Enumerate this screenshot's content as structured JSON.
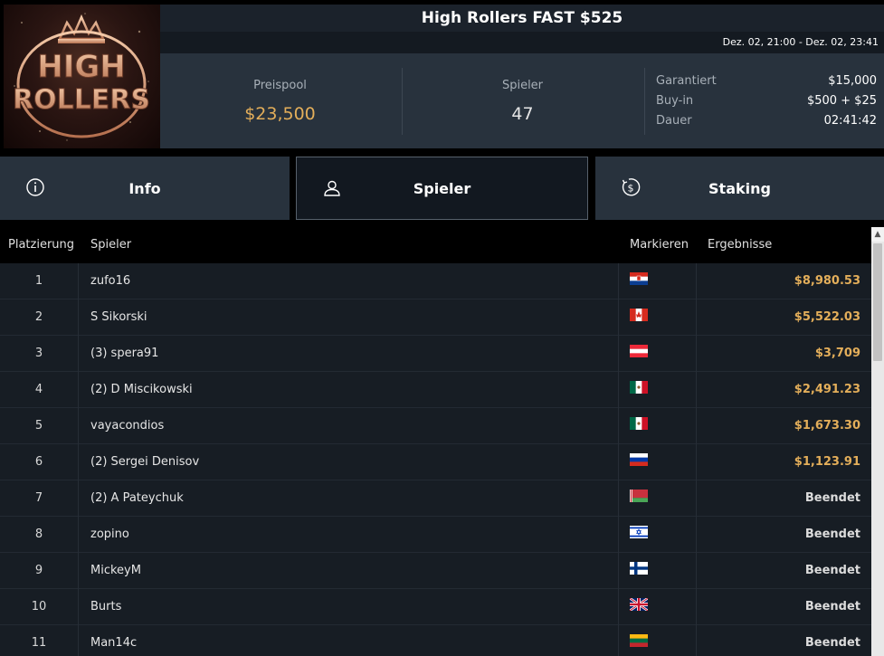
{
  "tournament": {
    "title": "High Rollers FAST $525",
    "date_range": "Dez. 02, 21:00 - Dez. 02, 23:41",
    "logo_text_top": "HIGH",
    "logo_text_bottom": "ROLLERS"
  },
  "stats": {
    "prize_pool_label": "Preispool",
    "prize_pool_value": "$23,500",
    "players_label": "Spieler",
    "players_value": "47",
    "details": [
      {
        "label": "Garantiert",
        "value": "$15,000"
      },
      {
        "label": "Buy-in",
        "value": "$500 + $25"
      },
      {
        "label": "Dauer",
        "value": "02:41:42"
      }
    ]
  },
  "tabs": [
    {
      "label": "Info",
      "icon": "info-icon",
      "active": false
    },
    {
      "label": "Spieler",
      "icon": "user-icon",
      "active": true
    },
    {
      "label": "Staking",
      "icon": "dollar-coin-icon",
      "active": false
    }
  ],
  "table": {
    "headers": {
      "place": "Platzierung",
      "player": "Spieler",
      "flag": "Markieren",
      "results": "Ergebnisse"
    },
    "rows": [
      {
        "place": "1",
        "name": "zufo16",
        "flag": "croatia",
        "result": "$8,980.53",
        "status": "prize"
      },
      {
        "place": "2",
        "name": "S Sikorski",
        "flag": "canada",
        "result": "$5,522.03",
        "status": "prize"
      },
      {
        "place": "3",
        "name": "(3) spera91",
        "flag": "austria",
        "result": "$3,709",
        "status": "prize"
      },
      {
        "place": "4",
        "name": "(2) D Miscikowski",
        "flag": "mexico",
        "result": "$2,491.23",
        "status": "prize"
      },
      {
        "place": "5",
        "name": "vayacondios",
        "flag": "mexico",
        "result": "$1,673.30",
        "status": "prize"
      },
      {
        "place": "6",
        "name": "(2) Sergei Denisov",
        "flag": "russia",
        "result": "$1,123.91",
        "status": "prize"
      },
      {
        "place": "7",
        "name": "(2) A Pateychuk",
        "flag": "belarus",
        "result": "Beendet",
        "status": "out"
      },
      {
        "place": "8",
        "name": "zopino",
        "flag": "israel",
        "result": "Beendet",
        "status": "out"
      },
      {
        "place": "9",
        "name": "MickeyM",
        "flag": "finland",
        "result": "Beendet",
        "status": "out"
      },
      {
        "place": "10",
        "name": "Burts",
        "flag": "uk",
        "result": "Beendet",
        "status": "out"
      },
      {
        "place": "11",
        "name": "Man14c",
        "flag": "lithuania",
        "result": "Beendet",
        "status": "out"
      }
    ]
  },
  "colors": {
    "gold": "#e3ae5a",
    "panel": "#28323d",
    "row": "#171d24"
  }
}
